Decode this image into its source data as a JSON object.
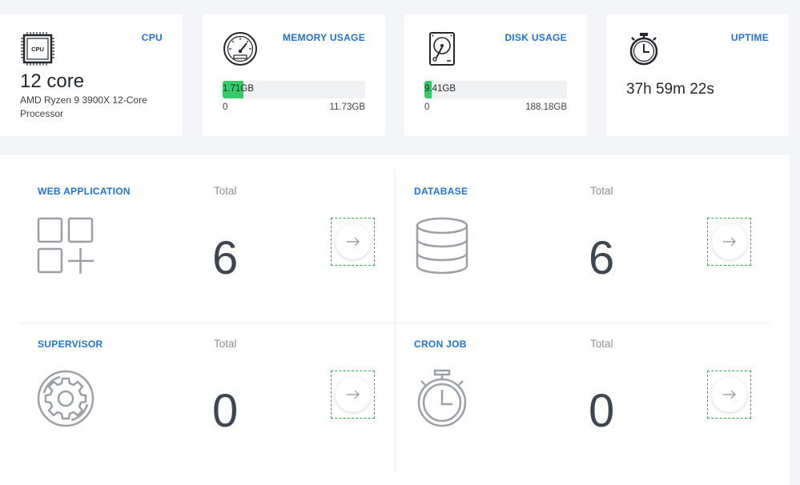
{
  "cpu": {
    "title": "CPU",
    "cores": "12 core",
    "model": "AMD Ryzen 9 3900X 12-Core Processor",
    "chip_label": "CPU"
  },
  "memory": {
    "title": "MEMORY USAGE",
    "used": "1.71GB",
    "used_fraction": 0.146,
    "min": "0",
    "max": "11.73GB"
  },
  "disk": {
    "title": "DISK USAGE",
    "used": "9.41GB",
    "used_fraction": 0.05,
    "min": "0",
    "max": "188.18GB"
  },
  "uptime": {
    "title": "UPTIME",
    "value": "37h 59m 22s"
  },
  "services": {
    "web": {
      "name": "WEB APPLICATION",
      "total_label": "Total",
      "count": "6"
    },
    "database": {
      "name": "DATABASE",
      "total_label": "Total",
      "count": "6"
    },
    "supervisor": {
      "name": "SUPERVISOR",
      "total_label": "Total",
      "count": "0"
    },
    "cron": {
      "name": "CRON JOB",
      "total_label": "Total",
      "count": "0"
    }
  },
  "colors": {
    "accent": "#1e73d3",
    "bar_fill": "#37c96a",
    "icon_gray": "#9aa0a6"
  },
  "icons": [
    "cpu-icon",
    "gauge-icon",
    "hard-disk-icon",
    "stopwatch-icon",
    "apps-add-icon",
    "database-icon",
    "gear-icon",
    "arrow-right-icon"
  ]
}
